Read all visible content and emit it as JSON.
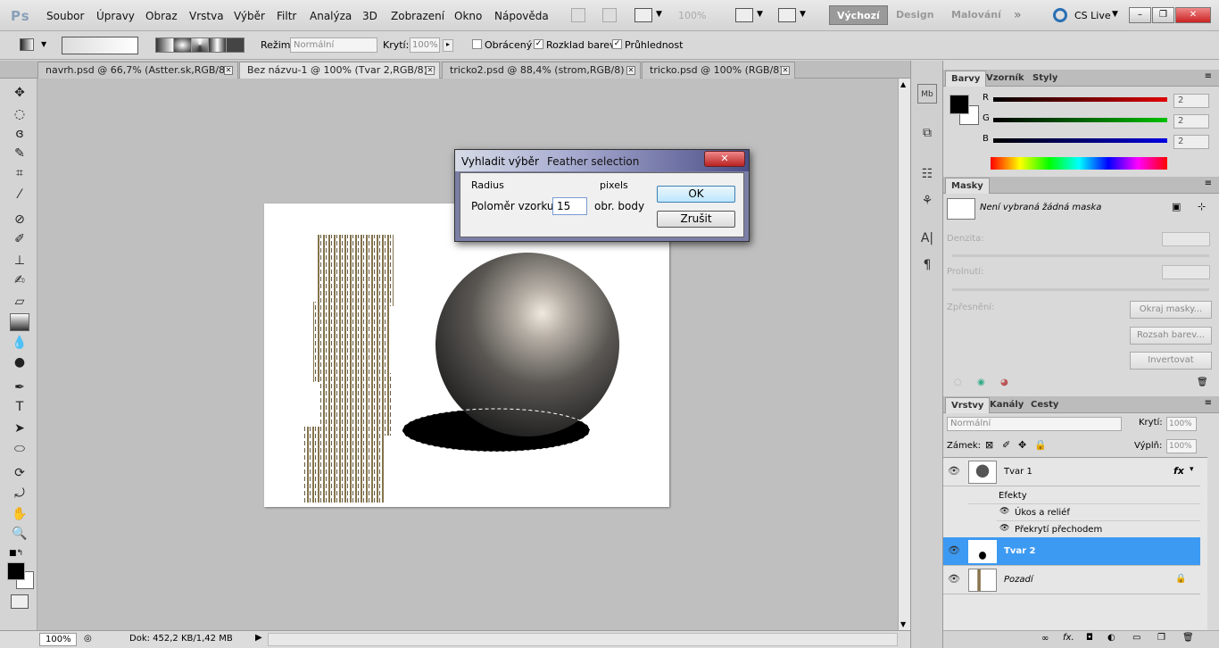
{
  "app": {
    "logo": "Ps"
  },
  "menu": [
    "Soubor",
    "Úpravy",
    "Obraz",
    "Vrstva",
    "Výběr",
    "Filtr",
    "Analýza",
    "3D",
    "Zobrazení",
    "Okno",
    "Nápověda"
  ],
  "menu_zoom": "100%",
  "workspaces": {
    "active": "Výchozí",
    "items": [
      "Design",
      "Malování"
    ]
  },
  "cslive": "CS Live",
  "options": {
    "mode_label": "Režim:",
    "mode_value": "Normální",
    "opacity_label": "Krytí:",
    "opacity_value": "100%",
    "reverse_label": "Obrácený",
    "reverse_checked": false,
    "dither_label": "Rozklad barev",
    "dither_checked": true,
    "transparency_label": "Průhlednost",
    "transparency_checked": true
  },
  "doc_tabs": [
    {
      "label": "navrh.psd @ 66,7% (Astter.sk,RGB/8)",
      "active": false
    },
    {
      "label": "Bez názvu-1 @ 100% (Tvar 2,RGB/8) *",
      "active": true
    },
    {
      "label": "tricko2.psd @ 88,4% (strom,RGB/8) *",
      "active": false
    },
    {
      "label": "tricko.psd @ 100% (RGB/8)",
      "active": false
    }
  ],
  "status": {
    "zoom": "100%",
    "doc": "Dok: 452,2 KB/1,42 MB"
  },
  "dialog": {
    "title": "Vyhladit výběr",
    "subtitle": "Feather selection",
    "radius_en": "Radius",
    "pixels_en": "pixels",
    "radius_label": "Poloměr vzorku:",
    "radius_value": "15",
    "unit": "obr. body",
    "ok": "OK",
    "cancel": "Zrušit"
  },
  "color_panel": {
    "tabs": [
      "Barvy",
      "Vzorník",
      "Styly"
    ],
    "channels": [
      {
        "name": "R",
        "value": "2",
        "color": "#e00000"
      },
      {
        "name": "G",
        "value": "2",
        "color": "#00c000"
      },
      {
        "name": "B",
        "value": "2",
        "color": "#0000e0"
      }
    ]
  },
  "masks_panel": {
    "tab": "Masky",
    "none": "Není vybraná žádná maska",
    "density": "Denzita:",
    "feather": "Prolnutí:",
    "refine": "Zpřesnění:",
    "btn_edge": "Okraj masky...",
    "btn_range": "Rozsah barev...",
    "btn_invert": "Invertovat"
  },
  "layers_panel": {
    "tabs": [
      "Vrstvy",
      "Kanály",
      "Cesty"
    ],
    "blend": "Normální",
    "opacity_label": "Krytí:",
    "opacity": "100%",
    "lock_label": "Zámek:",
    "fill_label": "Výplň:",
    "fill": "100%",
    "layers": [
      {
        "name": "Tvar 1",
        "fx": "fx",
        "selected": false
      },
      {
        "name": "Tvar 2",
        "selected": true
      },
      {
        "name": "Pozadí",
        "selected": false
      }
    ],
    "effects_label": "Efekty",
    "effects": [
      "Úkos a reliéf",
      "Překrytí přechodem"
    ]
  }
}
